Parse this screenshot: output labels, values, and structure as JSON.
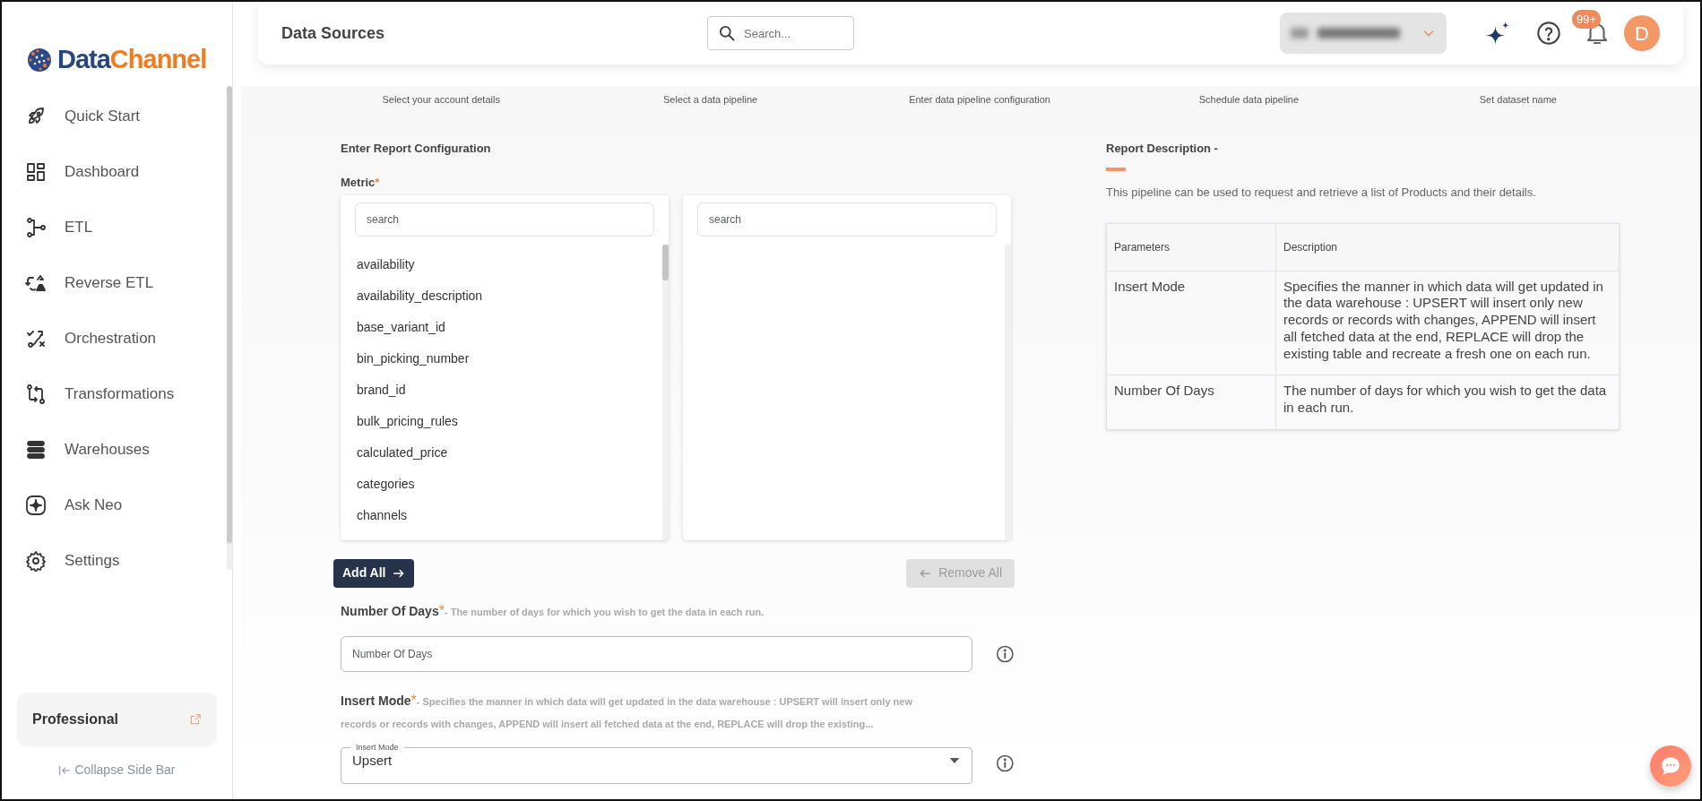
{
  "sidebar": {
    "logo": {
      "part_1": "Data",
      "part_2": "Channel"
    },
    "items": [
      {
        "label": "Quick Start",
        "selected": false
      },
      {
        "label": "Dashboard",
        "selected": false
      },
      {
        "label": "ETL",
        "selected": false
      },
      {
        "label": "Reverse ETL",
        "selected": false
      },
      {
        "label": "Orchestration",
        "selected": false
      },
      {
        "label": "Transformations",
        "selected": false
      },
      {
        "label": "Warehouses",
        "selected": false
      },
      {
        "label": "Ask Neo",
        "selected": false
      },
      {
        "label": "Settings",
        "selected": false
      }
    ],
    "plan": {
      "label": "Professional"
    },
    "collapse": "Collapse Side Bar"
  },
  "header": {
    "title": "Data Sources",
    "search": {
      "placeholder": "Search..."
    },
    "notifications": {
      "badge": "99+"
    },
    "avatar": "D"
  },
  "steps": [
    {
      "label": "Select your account details"
    },
    {
      "label": "Select a data pipeline"
    },
    {
      "label": "Enter data pipeline configuration"
    },
    {
      "label": "Schedule data pipeline"
    },
    {
      "label": "Set dataset name"
    }
  ],
  "config": {
    "title": "Enter Report Configuration",
    "metric": {
      "label": "Metric",
      "required_mark": "*",
      "available": {
        "placeholder": "search",
        "items": [
          "availability",
          "availability_description",
          "base_variant_id",
          "bin_picking_number",
          "brand_id",
          "bulk_pricing_rules",
          "calculated_price",
          "categories",
          "channels"
        ]
      },
      "chosen": {
        "placeholder": "search"
      },
      "add_all": "Add All",
      "remove_all": {
        "label": "Remove All",
        "disabled": true
      }
    },
    "fields": [
      {
        "kind": "text",
        "label": "Number Of Days",
        "required_mark": "*",
        "hint": "- The number of days for which you wish to get the data in each run.",
        "placeholder": "Number Of Days"
      },
      {
        "kind": "select",
        "label": "Insert Mode",
        "required_mark": "*",
        "hint": "- Specifies the manner in which data will get updated in the data warehouse : UPSERT will insert only new records or records with changes, APPEND will insert all fetched data at the end, REPLACE will drop the existing...",
        "floating_label": "Insert Mode",
        "value": "Upsert"
      }
    ]
  },
  "description": {
    "title": "Report Description -",
    "text": "This pipeline can be used to request and retrieve a list of Products and their details.",
    "table": {
      "columns": [
        "Parameters",
        "Description"
      ],
      "rows": [
        [
          "Insert Mode",
          "Specifies the manner in which data will get updated in the data warehouse : UPSERT will insert only new records or records with changes, APPEND will insert all fetched data at the end, REPLACE will drop the existing table and recreate a fresh one on each run."
        ],
        [
          "Number Of Days",
          "The number of days for which you wish to get the data in each run."
        ]
      ]
    }
  }
}
